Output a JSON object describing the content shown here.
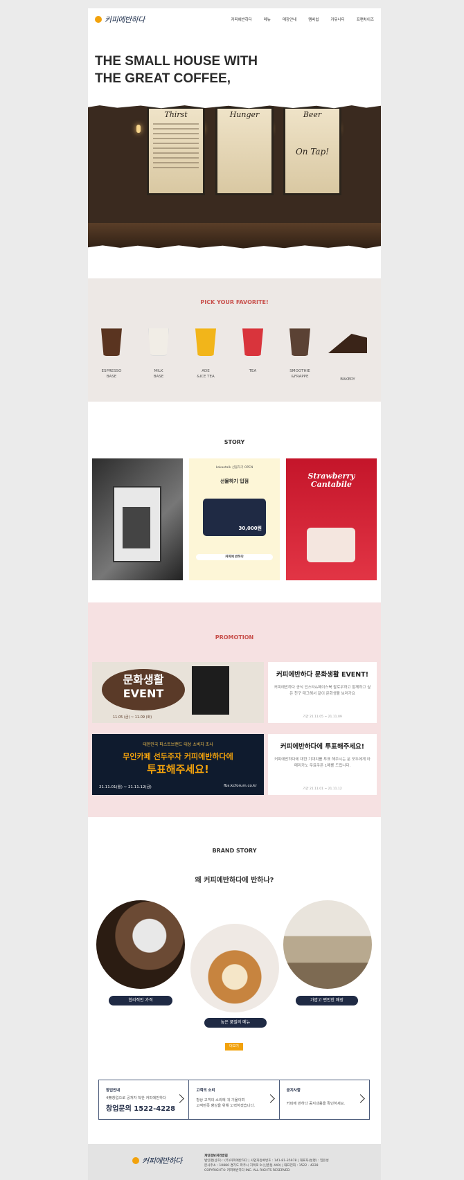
{
  "header": {
    "logo_text": "커피에반하다",
    "nav": [
      "커피에반하다",
      "메뉴",
      "매장안내",
      "멤버쉽",
      "커뮤니티",
      "프랜차이즈"
    ]
  },
  "hero": {
    "title_line1": "THE SMALL HOUSE WITH",
    "title_line2": "THE GREAT COFFEE,",
    "boards": [
      "Thirst",
      "Hunger",
      "Beer"
    ],
    "board3_sub": "On Tap!"
  },
  "pick": {
    "title": "PICK YOUR FAVORITE!",
    "products": [
      {
        "label": "ESPRESSO\nBASE",
        "color": "#5a3420"
      },
      {
        "label": "MILK\nBASE",
        "color": "#f1ede6"
      },
      {
        "label": "ADE\n&ICE TEA",
        "color": "#f2b51a"
      },
      {
        "label": "TEA",
        "color": "#d9343c"
      },
      {
        "label": "SMOOTHIE\n&FRAPPE",
        "color": "#5b4234"
      },
      {
        "label": "BAKERY",
        "color": "#3a2418"
      }
    ]
  },
  "story": {
    "title": "STORY",
    "card2_top": "kakaotalk 선물하기 OPEN",
    "card2_title": "선물하기 입점",
    "card2_amount": "30,000원",
    "card2_search": "커피에 반하다",
    "card3_title": "Strawberry Cantabile"
  },
  "promotion": {
    "title": "PROMOTION",
    "items": [
      {
        "banner_line1": "문화생활",
        "banner_line2": "EVENT",
        "banner_date": "11.05 (금) ~ 11.09 (화)",
        "heading": "커피에반하다 문화생활 EVENT!",
        "desc": "커피에반하다 공식 인스타&페이스북 팔로우하고 함께하고 싶은 친구 태그해서 같이 문화생활 보러가요",
        "date": "기간 21.11.05 ~ 21.11.09"
      },
      {
        "banner_top": "대한민국 퍼스트브랜드 대상 소비자 조사",
        "banner_line1": "무인카페 선두주자 커피에반하다에",
        "banner_line2": "투표해주세요!",
        "banner_date": "21.11.01(월) ~ 21.11.12(금)",
        "banner_url": "fbs.kcforum.co.kr",
        "heading": "커피에반하다에 투표해주세요!",
        "desc": "커피에반하다에 대한 기대치를 투표 해주시는 분 모두에게 아메리카노 무료쿠폰 1매를 드립니다.",
        "date": "기간 21.11.01 ~ 21.11.12"
      }
    ]
  },
  "brand": {
    "title": "BRAND STORY",
    "subtitle": "왜 커피에반하다에 반하나?",
    "pills": [
      "합리적인 가격",
      "높은 품질의 메뉴",
      "가깝고 편안한 매장"
    ],
    "more": "더보기"
  },
  "info": [
    {
      "head": "창업안내",
      "desc": "4無창업으로 공개자 착한 커피에반하다",
      "phone": "창업문의 1522-4228"
    },
    {
      "head": "고객의 소리",
      "desc": "항상 고객의 소리에 귀 기울이며\n고객만족 향상을 위해 노력하겠습니다."
    },
    {
      "head": "공지사항",
      "desc": "커피에 반하다 공지내용을 확인하세요."
    }
  ],
  "footer": {
    "logo_text": "커피에반하다",
    "head": "개인정보처리방침",
    "line1": "법인명(상호) : (주)커피에반하다 | 사업자등록번호 : 141-81-35978 | 대표자(성명) : 임은성",
    "line2": "본사주소 : 10880 경기도 파주시 지목로 9 (신촌동 440) | 대표전화 : 1522 - 4228",
    "line3": "COPYRIGHT© 커피에반하다 INC. ALL RIGHTS RESERVED"
  }
}
